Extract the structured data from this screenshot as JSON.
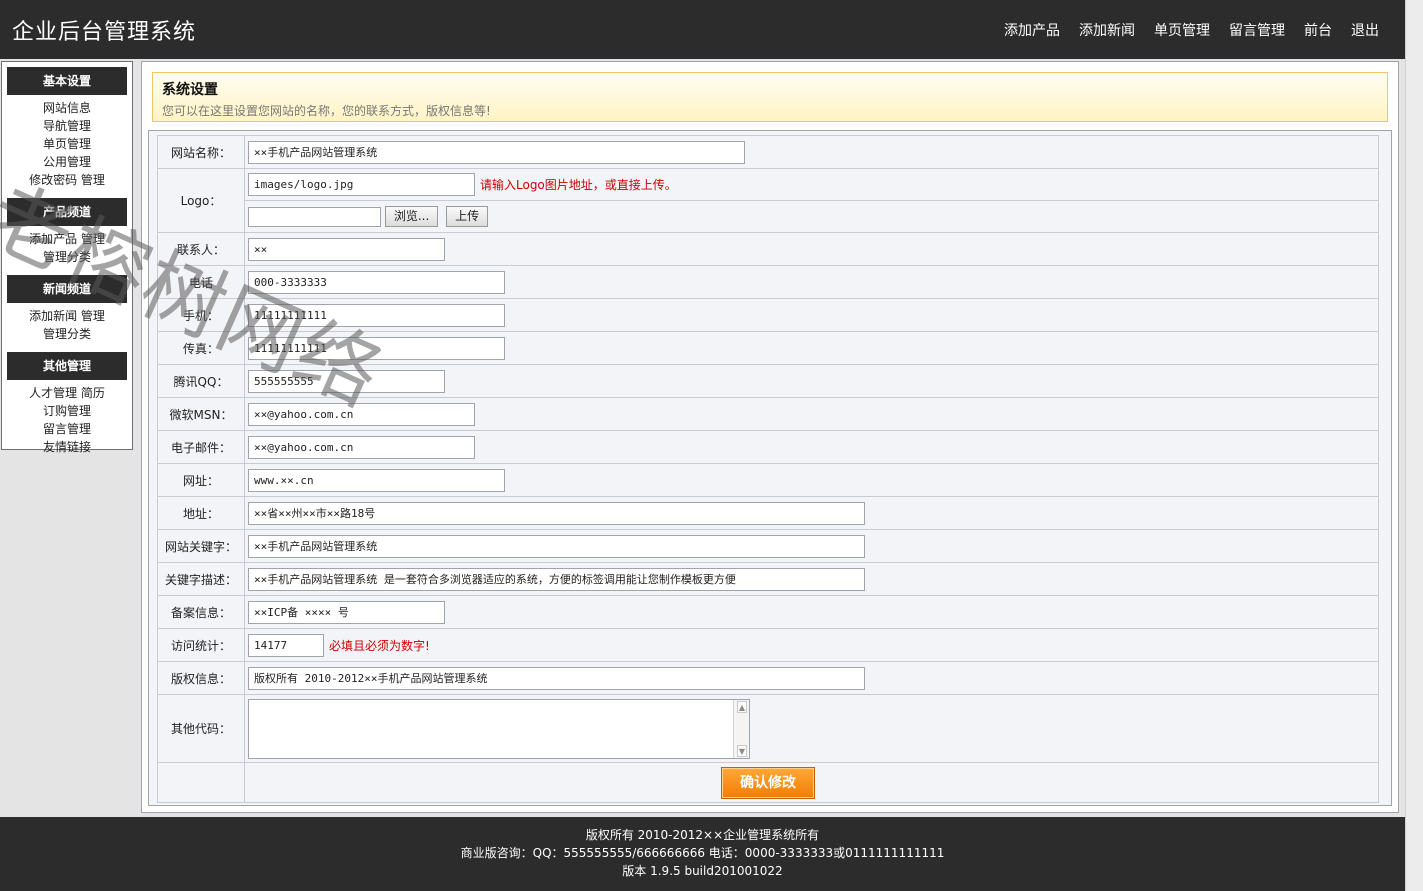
{
  "header": {
    "title": "企业后台管理系统",
    "nav": [
      "添加产品",
      "添加新闻",
      "单页管理",
      "留言管理",
      "前台",
      "退出"
    ]
  },
  "sidebar": {
    "groups": [
      {
        "title": "基本设置",
        "items": [
          "网站信息",
          "导航管理",
          "单页管理",
          "公用管理",
          "修改密码 管理"
        ]
      },
      {
        "title": "产品频道",
        "items": [
          "添加产品 管理",
          "管理分类"
        ]
      },
      {
        "title": "新闻频道",
        "items": [
          "添加新闻 管理",
          "管理分类"
        ]
      },
      {
        "title": "其他管理",
        "items": [
          "人才管理 简历",
          "订购管理",
          "留言管理",
          "友情链接"
        ]
      }
    ]
  },
  "notice": {
    "title": "系统设置",
    "desc": "您可以在这里设置您网站的名称，您的联系方式，版权信息等!"
  },
  "form": {
    "site_name": {
      "label": "网站名称：",
      "value": "××手机产品网站管理系统"
    },
    "logo": {
      "label": "Logo：",
      "value": "images/logo.jpg",
      "hint": "请输入Logo图片地址，或直接上传。",
      "browse": "浏览...",
      "upload": "上传"
    },
    "contact": {
      "label": "联系人：",
      "value": "××"
    },
    "phone": {
      "label": "电话",
      "value": "000-3333333"
    },
    "mobile": {
      "label": "手机：",
      "value": "11111111111"
    },
    "fax": {
      "label": "传真：",
      "value": "11111111111"
    },
    "qq": {
      "label": "腾讯QQ：",
      "value": "555555555"
    },
    "msn": {
      "label": "微软MSN：",
      "value": "××@yahoo.com.cn"
    },
    "email": {
      "label": "电子邮件：",
      "value": "××@yahoo.com.cn"
    },
    "url": {
      "label": "网址：",
      "value": "www.××.cn"
    },
    "address": {
      "label": "地址：",
      "value": "××省××州××市××路18号"
    },
    "keywords": {
      "label": "网站关键字：",
      "value": "××手机产品网站管理系统"
    },
    "description": {
      "label": "关键字描述：",
      "value": "××手机产品网站管理系统  是一套符合多浏览器适应的系统，方便的标签调用能让您制作模板更方便"
    },
    "icp": {
      "label": "备案信息：",
      "value": "××ICP备 ×××× 号"
    },
    "stats": {
      "label": "访问统计：",
      "value": "14177",
      "hint": "必填且必须为数字!"
    },
    "copyright": {
      "label": "版权信息：",
      "value": "版权所有 2010-2012××手机产品网站管理系统"
    },
    "other_code": {
      "label": "其他代码：",
      "value": ""
    },
    "submit": "确认修改"
  },
  "footer": {
    "line1": "版权所有 2010-2012××企业管理系统所有",
    "line2": "商业版咨询：QQ：555555555/666666666 电话：0000-3333333或0111111111111",
    "line3": "版本 1.9.5 build201001022"
  },
  "watermark": "老榕树网络"
}
